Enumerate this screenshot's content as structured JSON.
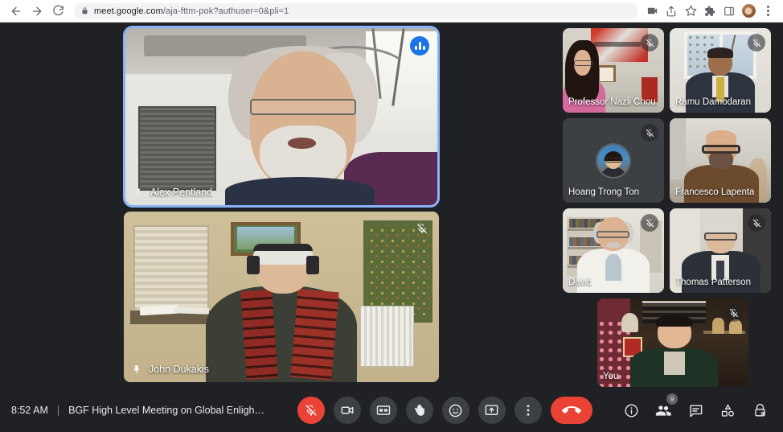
{
  "browser": {
    "back_label": "Back",
    "forward_label": "Forward",
    "reload_label": "Reload",
    "url_host": "meet.google.com",
    "url_path": "/aja-fttm-pok?authuser=0&pli=1",
    "url_full": "meet.google.com/aja-fttm-pok?authuser=0&pli=1",
    "icons": {
      "lock": "lock-icon",
      "media_cast": "media-cast-icon",
      "share": "share-icon",
      "bookmark": "bookmark-star-icon",
      "extensions": "extensions-puzzle-icon",
      "side_panel": "side-panel-icon",
      "profile": "profile-avatar-icon",
      "menu": "three-dot-menu-icon"
    }
  },
  "meeting": {
    "time": "8:52 AM",
    "separator": "|",
    "title": "BGF High Level Meeting on Global Enlightenm…",
    "participant_count": "9",
    "accent_active_border": "#8ab4f8",
    "accent_audio": "#1a73e8",
    "danger": "#ea4335",
    "surface": "#3c4043",
    "background": "#202124"
  },
  "main_tiles": [
    {
      "name": "Alex Pentland",
      "pinned": true,
      "muted": false,
      "speaking": true,
      "active_border": true,
      "scene": "sc-alex"
    },
    {
      "name": "John Dukakis",
      "pinned": true,
      "muted": true,
      "speaking": false,
      "active_border": false,
      "scene": "sc-john"
    }
  ],
  "participants": [
    {
      "name": "Professor Nazli Chou…",
      "muted": true,
      "camera_off": false,
      "scene": "sc-nazli"
    },
    {
      "name": "Ramu Damodaran",
      "muted": true,
      "camera_off": false,
      "scene": "sc-ramu"
    },
    {
      "name": "Hoang Trong Ton",
      "muted": true,
      "camera_off": true,
      "scene": ""
    },
    {
      "name": "Francesco Lapenta",
      "muted": false,
      "camera_off": false,
      "scene": "sc-fran"
    },
    {
      "name": "David",
      "muted": true,
      "camera_off": false,
      "scene": "sc-david"
    },
    {
      "name": "Thomas Patterson",
      "muted": true,
      "camera_off": false,
      "scene": "sc-thomas"
    },
    {
      "name": "You",
      "muted": true,
      "camera_off": false,
      "scene": "sc-you"
    }
  ],
  "controls": [
    {
      "id": "microphone",
      "label": "Turn on microphone",
      "icon": "mic-off-icon",
      "state": "muted"
    },
    {
      "id": "camera",
      "label": "Turn off camera",
      "icon": "video-camera-icon",
      "state": "on"
    },
    {
      "id": "captions",
      "label": "Turn on captions",
      "icon": "closed-caption-icon",
      "state": "off"
    },
    {
      "id": "raise-hand",
      "label": "Raise hand",
      "icon": "raise-hand-icon",
      "state": "off"
    },
    {
      "id": "reactions",
      "label": "Send a reaction",
      "icon": "emoji-smiley-icon",
      "state": "off"
    },
    {
      "id": "present",
      "label": "Present now",
      "icon": "present-screen-icon",
      "state": "off"
    },
    {
      "id": "more-options",
      "label": "More options",
      "icon": "three-dot-menu-icon",
      "state": "off"
    },
    {
      "id": "leave-call",
      "label": "Leave call",
      "icon": "end-call-phone-icon",
      "state": "danger"
    }
  ],
  "right_controls": [
    {
      "id": "meeting-details",
      "label": "Meeting details",
      "icon": "info-circle-icon",
      "badge": ""
    },
    {
      "id": "people",
      "label": "Show everyone",
      "icon": "people-icon",
      "badge": "9"
    },
    {
      "id": "chat",
      "label": "Chat with everyone",
      "icon": "chat-bubble-icon",
      "badge": ""
    },
    {
      "id": "activities",
      "label": "Activities",
      "icon": "activities-shapes-icon",
      "badge": ""
    },
    {
      "id": "host-controls",
      "label": "Host controls",
      "icon": "lock-shield-icon",
      "badge": ""
    }
  ]
}
